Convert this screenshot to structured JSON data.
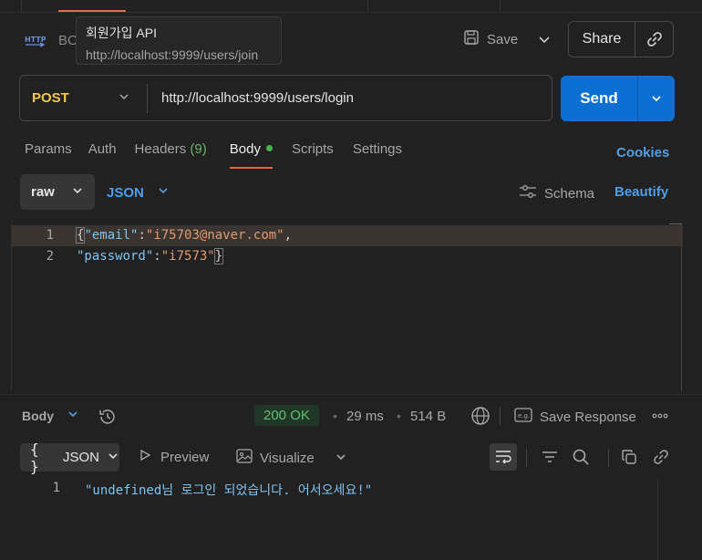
{
  "request": {
    "icon": "http-icon",
    "name_visible": "BO",
    "tooltip": {
      "title": "회원가입 API",
      "url": "http://localhost:9999/users/join"
    },
    "save_label": "Save",
    "share_label": "Share",
    "method": "POST",
    "url": "http://localhost:9999/users/login",
    "send_label": "Send"
  },
  "tabs": [
    {
      "label": "Params"
    },
    {
      "label": "Auth"
    },
    {
      "label": "Headers",
      "count": "(9)"
    },
    {
      "label": "Body",
      "active": true,
      "indicator": true
    },
    {
      "label": "Scripts"
    },
    {
      "label": "Settings"
    }
  ],
  "cookies_label": "Cookies",
  "body_toolbar": {
    "mode": "raw",
    "format": "JSON",
    "schema_label": "Schema",
    "beautify_label": "Beautify"
  },
  "editor": {
    "lines": [
      {
        "num": "1",
        "key": "\"email\"",
        "colon": ":",
        "value": "\"i75703@naver.com\"",
        "trail": ","
      },
      {
        "num": "2",
        "key": "\"password\"",
        "colon": ":",
        "value": "\"i7573\"",
        "trail": ""
      }
    ],
    "open_brace": "{",
    "close_brace": "}"
  },
  "response": {
    "section_label": "Body",
    "status": "200 OK",
    "time": "29 ms",
    "size": "514 B",
    "save_response_label": "Save Response",
    "format_label": "JSON",
    "preview_label": "Preview",
    "visualize_label": "Visualize",
    "line_num": "1",
    "body_text": "\"undefined님 로그인 되었습니다. 어서오세요!\""
  },
  "colors": {
    "accent": "#0d6fd1",
    "method": "#f2c94c",
    "link": "#4f9de6",
    "status_ok": "#62c174",
    "active_tab": "#e06a3b"
  }
}
